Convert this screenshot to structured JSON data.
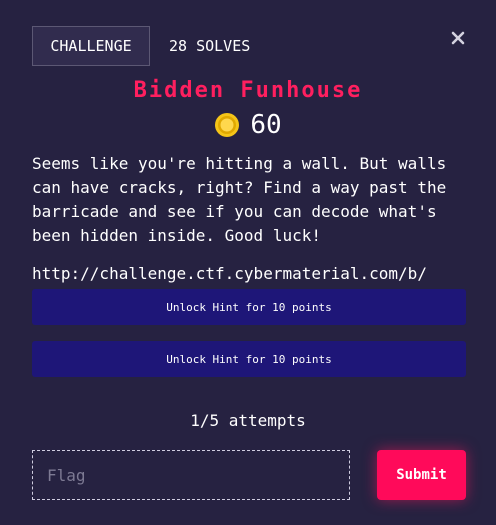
{
  "header": {
    "tab_challenge": "CHALLENGE",
    "tab_solves": "28 SOLVES"
  },
  "challenge": {
    "title": "Bidden Funhouse",
    "value": "60",
    "description": "Seems like you're hitting a wall. But walls can have cracks, right? Find a way past the barricade and see if you can decode what's been hidden inside. Good luck!",
    "link": "http://challenge.ctf.cybermaterial.com/b/"
  },
  "hints": [
    {
      "label": "Unlock Hint for 10 points"
    },
    {
      "label": "Unlock Hint for 10 points"
    }
  ],
  "attempts": "1/5 attempts",
  "form": {
    "flag_placeholder": "Flag",
    "flag_value": "",
    "submit_label": "Submit"
  },
  "icons": {
    "close": "close-icon",
    "coin": "coin-icon"
  },
  "colors": {
    "background": "#262241",
    "title": "#ff1f5f",
    "hint_button": "#1e1678",
    "submit_button": "#ff0a5a",
    "coin": "#f5c518"
  }
}
